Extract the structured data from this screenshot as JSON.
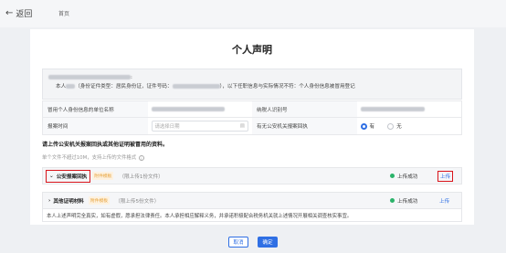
{
  "header": {
    "back_label": "返回",
    "breadcrumb": "首页"
  },
  "page": {
    "title": "个人声明"
  },
  "declaration": {
    "line1_suffix": ":",
    "line2_prefix": "本人",
    "line2_text": "（身份证件类型：居民身份证，证件号码：",
    "line2_suffix": "），以下任职信息与实际情况不符：个人身份信息被冒用登记"
  },
  "form": {
    "rows": [
      {
        "label1": "冒用个人身份信息的单位名称",
        "value1": "",
        "label2": "纳税人识别号",
        "value2": ""
      },
      {
        "label1": "报案时间",
        "date_placeholder": "请选择日期",
        "label2": "有无公安机关报案回执",
        "radio_yes": "有",
        "radio_no": "无",
        "radio_selected": "有"
      }
    ]
  },
  "upload": {
    "title": "请上传公安机关报案回执或其他证明被冒用的资料。",
    "hint": "单个文件不超过10M，支持上传的文件格式",
    "files": [
      {
        "name": "公安报案回执",
        "tag": "附件模板",
        "note": "（限上传1份文件）",
        "status": "上传成功",
        "action": "上传"
      },
      {
        "name": "其他证明材料",
        "tag": "附件模板",
        "note": "（限上传5份文件）",
        "status": "上传成功",
        "action": "上传"
      }
    ],
    "statement": "本人上述声明完全真实，如有虚假，愿承担法律责任。本人承担相应解释义务，并承诺积极配合税务机关就上述情况开展相关调查核实事宜。"
  },
  "footer": {
    "cancel_label": "取消",
    "confirm_label": "确定"
  },
  "colors": {
    "accent": "#2f6fe4",
    "highlight": "#d9141b",
    "success": "#2bb36a",
    "tag": "#e7a23a"
  }
}
